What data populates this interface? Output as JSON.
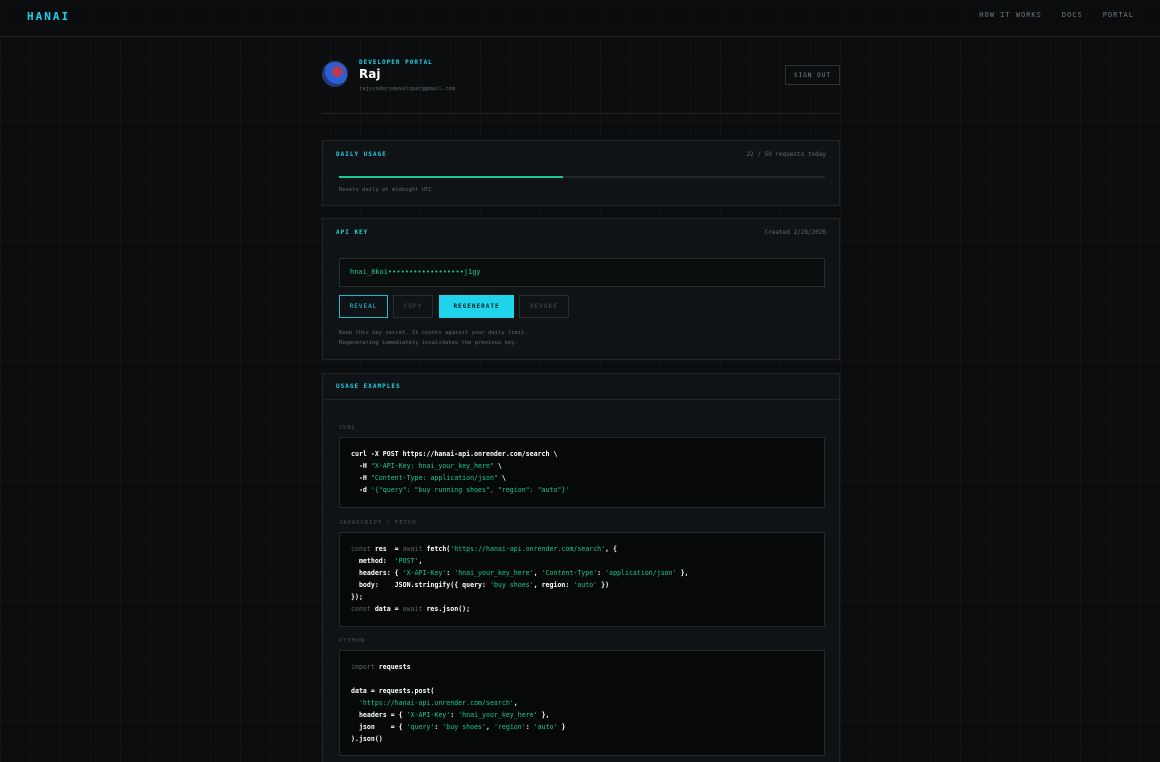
{
  "brand": "HANAI",
  "nav": [
    "HOW IT WORKS",
    "DOCS",
    "PORTAL"
  ],
  "profile": {
    "label": "DEVELOPER PORTAL",
    "name": "Raj",
    "email": "rajvcodersdeveloper@gmail.com",
    "signout": "SIGN OUT"
  },
  "usage": {
    "title": "DAILY USAGE",
    "count_text": "22 / 50 requests today",
    "used": 22,
    "limit": 50,
    "progress_fraction": 0.46,
    "hint": "Resets daily at midnight UTC"
  },
  "apikey": {
    "title": "API KEY",
    "created": "Created 2/28/2026",
    "masked_key": "hnai_8koi••••••••••••••••••j1gy",
    "buttons": {
      "reveal": "REVEAL",
      "copy": "COPY",
      "regenerate": "REGENERATE",
      "revoke": "REVOKE"
    },
    "hint_line1": "Keep this key secret. It counts against your daily limit.",
    "hint_line2": "Regenerating immediately invalidates the previous key."
  },
  "examples": {
    "title": "USAGE EXAMPLES",
    "curl_label": "CURL",
    "js_label": "JAVASCRIPT / FETCH",
    "python_label": "PYTHON",
    "curl": {
      "l1": "curl -X POST https://hanai-api.onrender.com/search \\",
      "l2a": "  -H ",
      "l2s": "\"X-API-Key: hnai_your_key_here\"",
      "l2b": " \\",
      "l3a": "  -H ",
      "l3s": "\"Content-Type: application/json\"",
      "l3b": " \\",
      "l4a": "  -d ",
      "l4s": "'{\"query\": \"buy running shoes\", \"region\": \"auto\"}'"
    },
    "js": {
      "l1k": "const",
      "l1a": " res  = ",
      "l1k2": "await",
      "l1b": " fetch(",
      "l1s": "'https://hanai-api.onrender.com/search'",
      "l1c": ", {",
      "l2a": "  method:  ",
      "l2s": "'POST'",
      "l2b": ",",
      "l3a": "  headers: { ",
      "l3s1": "'X-API-Key'",
      "l3b": ": ",
      "l3s2": "'hnai_your_key_here'",
      "l3c": ", ",
      "l3s3": "'Content-Type'",
      "l3d": ": ",
      "l3s4": "'application/json'",
      "l3e": " },",
      "l4a": "  body:    JSON.stringify({ query: ",
      "l4s1": "'buy shoes'",
      "l4b": ", region: ",
      "l4s2": "'auto'",
      "l4c": " })",
      "l5": "});",
      "l6k": "const",
      "l6a": " data = ",
      "l6k2": "await",
      "l6b": " res.json();"
    },
    "python": {
      "l1k": "import",
      "l1a": " requests",
      "l2": "data = requests.post(",
      "l3s": "  'https://hanai-api.onrender.com/search'",
      "l3a": ",",
      "l4a": "  headers = { ",
      "l4s1": "'X-API-Key'",
      "l4b": ": ",
      "l4s2": "'hnai_your_key_here'",
      "l4c": " },",
      "l5a": "  json    = { ",
      "l5s1": "'query'",
      "l5b": ": ",
      "l5s2": "'buy shoes'",
      "l5c": ", ",
      "l5s3": "'region'",
      "l5d": ": ",
      "l5s4": "'auto'",
      "l5e": " }",
      "l6": ").json()"
    }
  }
}
